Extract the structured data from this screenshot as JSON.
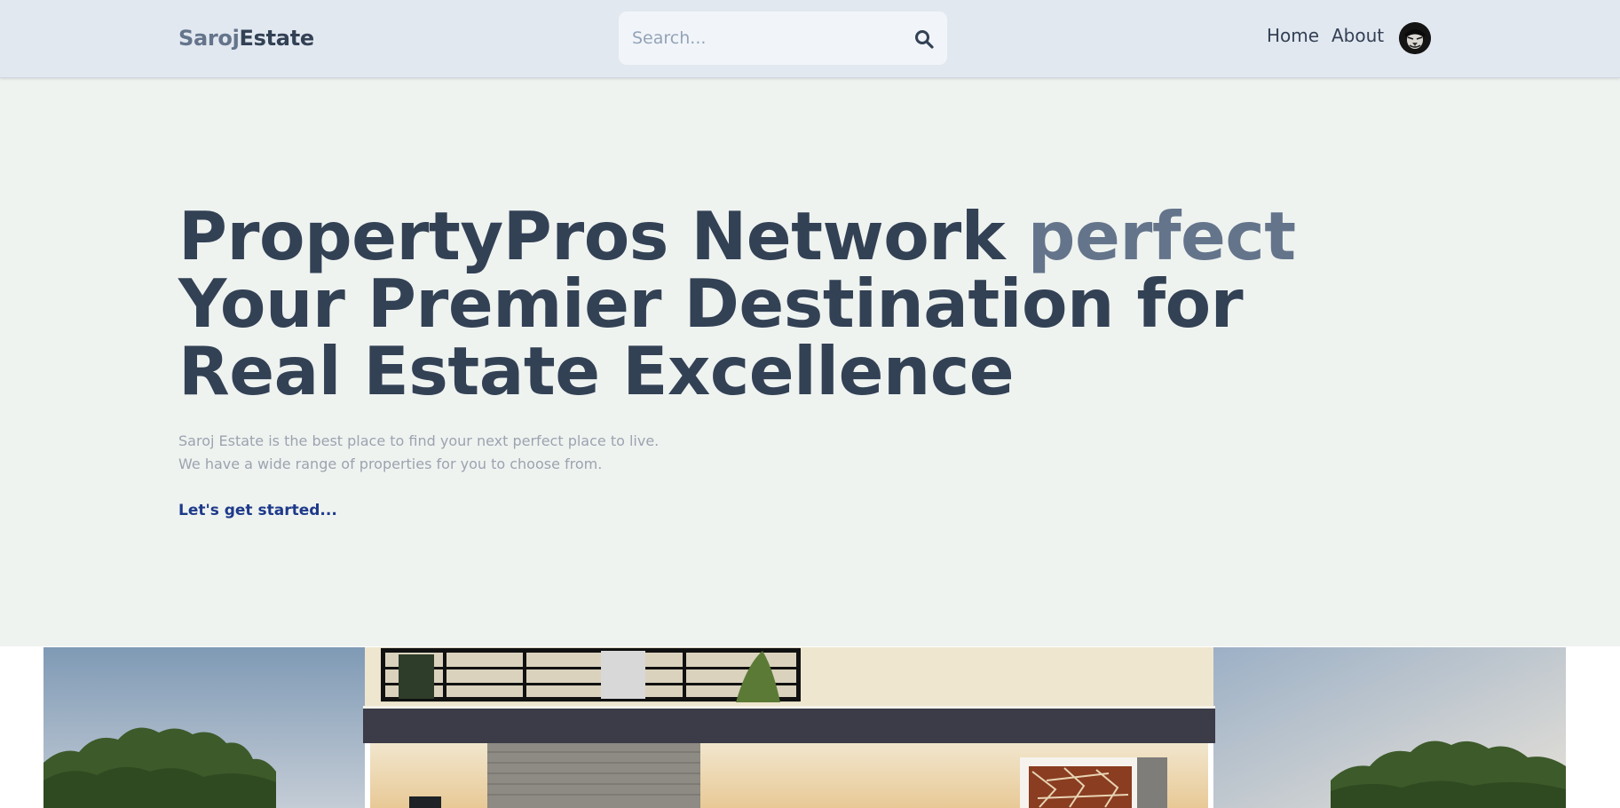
{
  "header": {
    "logo_part1": "Saroj",
    "logo_part2": "Estate",
    "search": {
      "placeholder": "Search..."
    },
    "nav": {
      "home": "Home",
      "about": "About"
    }
  },
  "hero": {
    "title_main": "PropertyPros Network ",
    "title_accent": "perfect",
    "title_rest": "Your Premier Destination for Real Estate Excellence",
    "description_line1": "Saroj Estate is the best place to find your next perfect place to live.",
    "description_line2": "We have a wide range of properties for you to choose from.",
    "cta": "Let's get started..."
  },
  "icons": {
    "search": "search-icon",
    "avatar": "user-avatar"
  },
  "colors": {
    "header_bg": "#e2e8f0",
    "hero_bg": "#eff3f0",
    "title": "#334155",
    "accent": "#64748b",
    "link": "#1e3a8a"
  }
}
